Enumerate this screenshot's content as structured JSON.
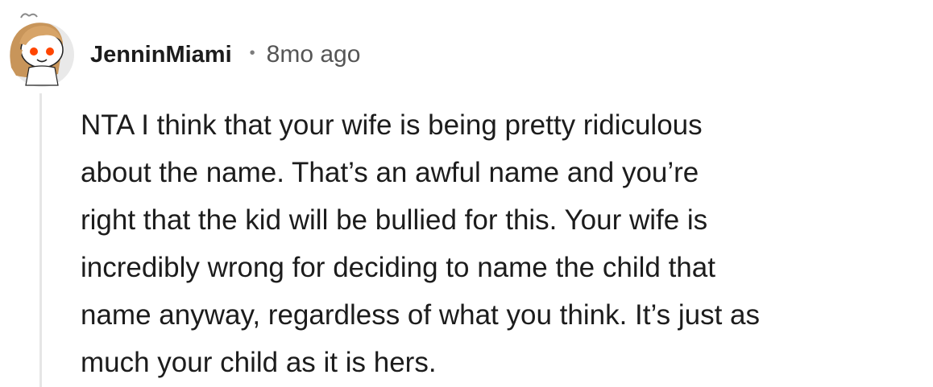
{
  "comment": {
    "author": "JenninMiami",
    "separator": "•",
    "age": "8mo ago",
    "avatar_icon": "snoo-avatar-icon",
    "body": "NTA I think that your wife is being pretty ridiculous\nabout the name. That’s an awful name and you’re\nright that the kid will be bullied for this. Your wife is\nincredibly wrong for deciding to name the child that\nname anyway, regardless of what you think. It’s just as\nmuch your child as it is hers."
  }
}
